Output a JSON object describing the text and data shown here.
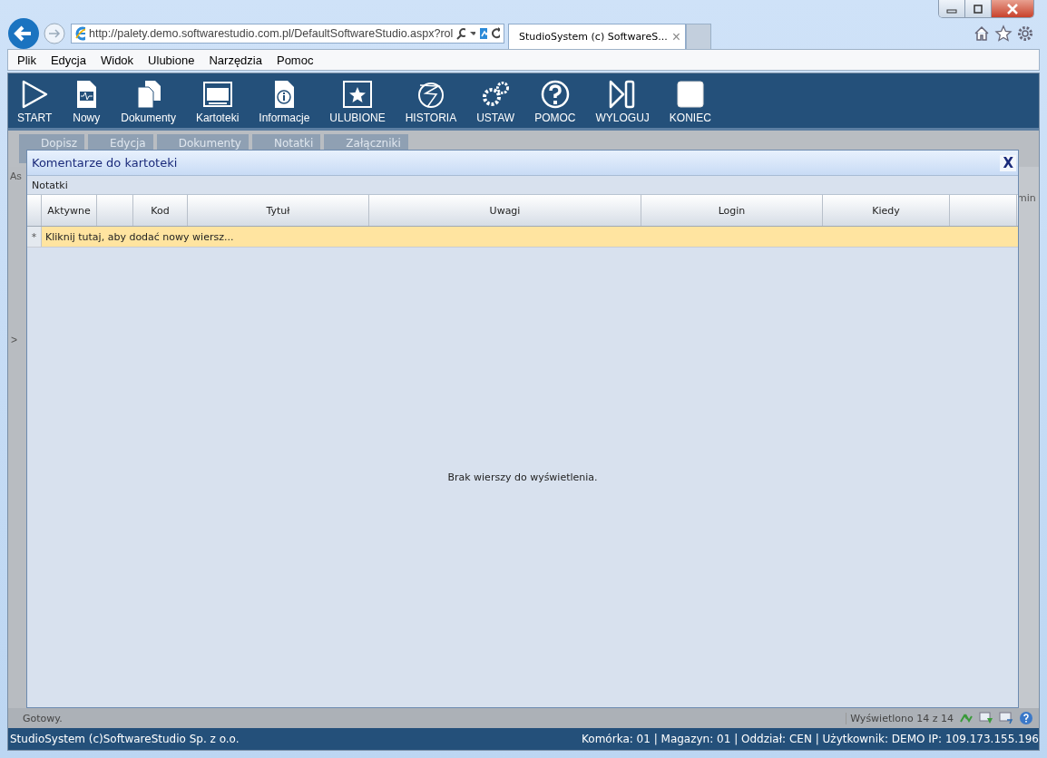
{
  "browser": {
    "address": "http://palety.demo.softwarestudio.com.pl/DefaultSoftwareStudio.aspx?rol",
    "tab_title": "StudioSystem (c) SoftwareS...",
    "tab_close": "×"
  },
  "menu": [
    "Plik",
    "Edycja",
    "Widok",
    "Ulubione",
    "Narzędzia",
    "Pomoc"
  ],
  "toolbar": [
    {
      "label": "START"
    },
    {
      "label": "Nowy"
    },
    {
      "label": "Dokumenty"
    },
    {
      "label": "Kartoteki"
    },
    {
      "label": "Informacje"
    },
    {
      "label": "ULUBIONE"
    },
    {
      "label": "HISTORIA"
    },
    {
      "label": "USTAW"
    },
    {
      "label": "POMOC"
    },
    {
      "label": "WYLOGUJ"
    },
    {
      "label": "KONIEC"
    }
  ],
  "sub_toolbar": [
    "Dopisz",
    "Edycja",
    "Dokumenty",
    "Notatki",
    "Załączniki"
  ],
  "background_grid": {
    "left_header": "As",
    "right_header": "min",
    "expander": ">"
  },
  "dialog": {
    "title": "Komentarze do kartoteki",
    "close": "X",
    "section": "Notatki",
    "columns": [
      {
        "label": "Aktywne"
      },
      {},
      {
        "label": "Kod"
      },
      {
        "label": "Tytuł"
      },
      {
        "label": "Uwagi"
      },
      {
        "label": "Login"
      },
      {
        "label": "Kiedy"
      },
      {}
    ],
    "new_row": {
      "marker": "*",
      "text": "Kliknij tutaj, aby dodać nowy wiersz..."
    },
    "empty_text": "Brak wierszy do wyświetlenia."
  },
  "status": {
    "left": "Gotowy.",
    "count": "Wyświetlono 14 z 14"
  },
  "footer": {
    "left": "StudioSystem (c)SoftwareStudio Sp. z o.o.",
    "right": "Komórka: 01 | Magazyn: 01 | Oddział: CEN | Użytkownik: DEMO IP: 109.173.155.196"
  }
}
